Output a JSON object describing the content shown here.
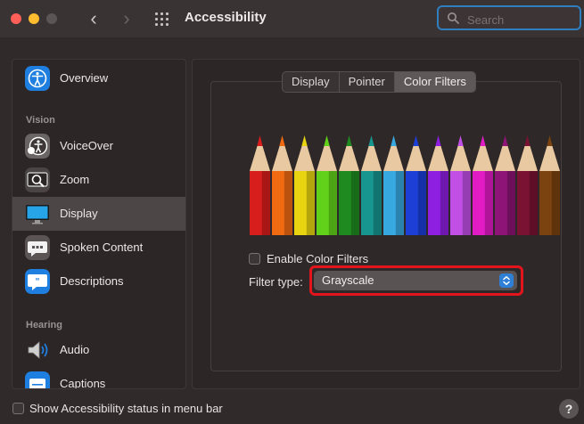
{
  "window": {
    "title": "Accessibility"
  },
  "toolbar": {
    "back_glyph": "‹",
    "forward_glyph": "›",
    "search_placeholder": "Search"
  },
  "sidebar": {
    "items": [
      {
        "label": "Overview",
        "icon": "overview-icon"
      },
      {
        "label": "VoiceOver",
        "icon": "voiceover-icon"
      },
      {
        "label": "Zoom",
        "icon": "zoom-icon"
      },
      {
        "label": "Display",
        "icon": "display-icon",
        "selected": true
      },
      {
        "label": "Spoken Content",
        "icon": "spoken-content-icon"
      },
      {
        "label": "Descriptions",
        "icon": "descriptions-icon"
      },
      {
        "label": "Audio",
        "icon": "audio-icon"
      },
      {
        "label": "Captions",
        "icon": "captions-icon"
      }
    ],
    "headers": {
      "vision": "Vision",
      "hearing": "Hearing"
    }
  },
  "tabs": [
    {
      "label": "Display"
    },
    {
      "label": "Pointer"
    },
    {
      "label": "Color Filters",
      "active": true
    }
  ],
  "pencil_colors": [
    "#d81d1d",
    "#f06a12",
    "#e8d410",
    "#62d11a",
    "#1f8a1f",
    "#17958f",
    "#37a8e0",
    "#1d3fd6",
    "#8e1fe0",
    "#c14fe6",
    "#e21cc4",
    "#8e1477",
    "#7a1333",
    "#7a4310"
  ],
  "color_filters": {
    "enable_label": "Enable Color Filters",
    "enabled": false,
    "filter_type_label": "Filter type:",
    "filter_type_value": "Grayscale"
  },
  "footer": {
    "status_label": "Show Accessibility status in menu bar",
    "status_checked": false,
    "help_glyph": "?"
  },
  "colors": {
    "accent": "#2f7fd6",
    "highlight": "#e3141b"
  }
}
